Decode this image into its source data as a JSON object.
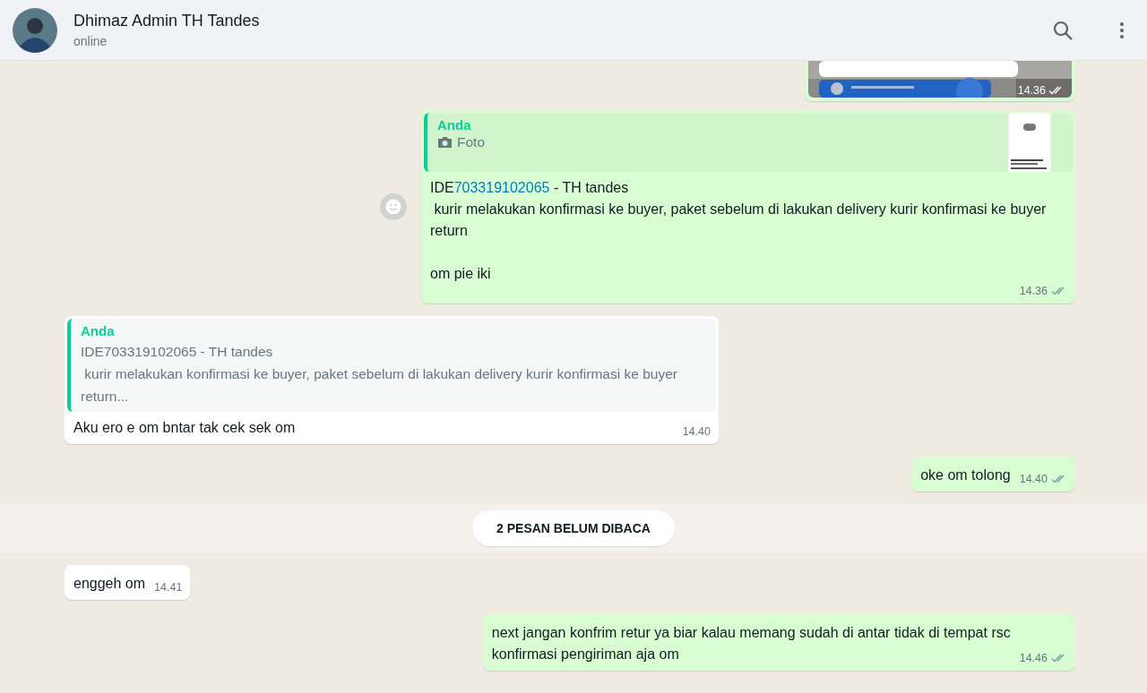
{
  "header": {
    "name": "Dhimaz Admin TH Tandes",
    "status": "online"
  },
  "messages": [
    {
      "outgoing": true,
      "time": "14.36",
      "read": false
    },
    {
      "kind": "text",
      "outgoing": true,
      "reaction_button": true,
      "quote": {
        "author": "Anda",
        "label": "Foto",
        "thumbnail": true
      },
      "body": [
        {
          "kind": "plain",
          "text": "IDE"
        },
        {
          "kind": "link",
          "text": "703319102065"
        },
        {
          "kind": "plain",
          "text": " - TH tandes\n kurir melakukan konfirmasi ke buyer, paket sebelum di lakukan delivery kurir konfirmasi ke buyer return\n\nom pie iki"
        }
      ],
      "time": "14.36",
      "read": false
    },
    {
      "kind": "text",
      "outgoing": false,
      "reaction_button": false,
      "quote": {
        "author": "Anda",
        "text": "IDE703319102065 - TH tandes\n kurir melakukan konfirmasi ke buyer, paket sebelum di lakukan delivery kurir konfirmasi ke buyer return...",
        "thumbnail": false
      },
      "body": [
        {
          "kind": "plain",
          "text": "Aku ero e om bntar tak cek sek om"
        }
      ],
      "time": "14.40"
    },
    {
      "kind": "text",
      "outgoing": true,
      "reaction_button": false,
      "body": [
        {
          "kind": "plain",
          "text": "oke om tolong"
        }
      ],
      "time": "14.40",
      "read": false
    },
    {
      "kind": "divider",
      "text": "2 PESAN BELUM DIBACA"
    },
    {
      "kind": "text",
      "outgoing": false,
      "reaction_button": false,
      "body": [
        {
          "kind": "plain",
          "text": "enggeh om"
        }
      ],
      "time": "14.41"
    },
    {
      "kind": "text",
      "outgoing": true,
      "reaction_button": false,
      "body": [
        {
          "kind": "plain",
          "text": "next jangan konfrim retur ya biar kalau memang sudah di antar tidak di tempat rsc\nkonfirmasi pengiriman aja om"
        }
      ],
      "time": "14.46",
      "read": false
    }
  ]
}
